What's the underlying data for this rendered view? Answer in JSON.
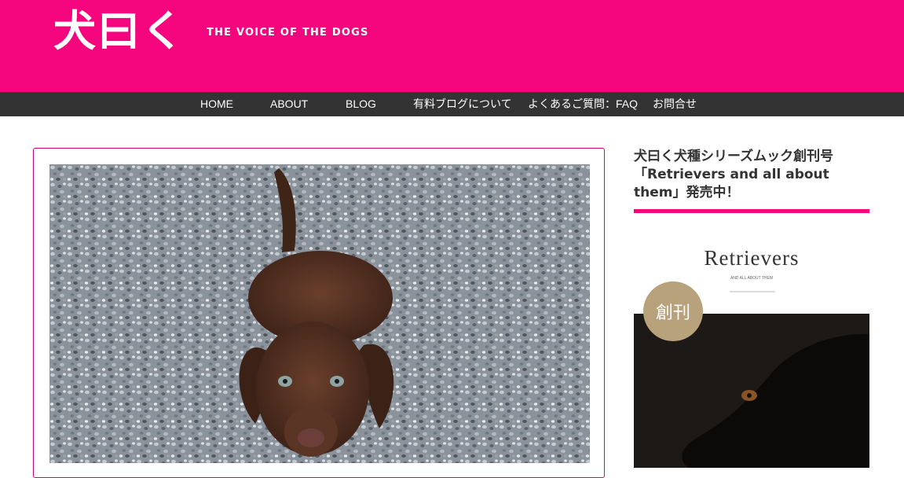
{
  "header": {
    "logo_text": "犬曰く",
    "tagline": "THE VOICE OF THE DOGS",
    "background_color": "#f5057d"
  },
  "nav": {
    "items": [
      {
        "label": "HOME"
      },
      {
        "label": "ABOUT"
      },
      {
        "label": "BLOG"
      },
      {
        "label": "有料ブログについて"
      },
      {
        "label": "よくあるご質問：FAQ"
      },
      {
        "label": "お問合せ"
      }
    ],
    "background_color": "#333333"
  },
  "main": {
    "post_image_alt": "chocolate-labrador-puppy-photo"
  },
  "sidebar": {
    "heading_line1": "犬曰く犬種シリーズムック創刊号",
    "heading_line2": "「Retrievers and all about",
    "heading_line3": "them」発売中！",
    "accent_color": "#f5057d",
    "book": {
      "title": "Retrievers",
      "subtitle": "AND ALL ABOUT THEM",
      "badge": "創刊"
    }
  }
}
